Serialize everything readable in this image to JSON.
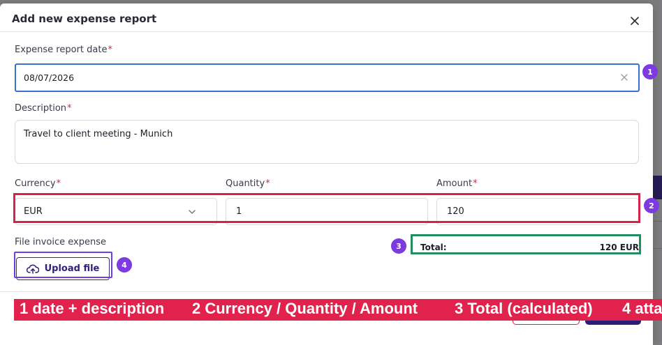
{
  "modal": {
    "title": "Add new expense report"
  },
  "form": {
    "date": {
      "label": "Expense report date",
      "required_mark": "*",
      "value": "08/07/2026"
    },
    "description": {
      "label": "Description",
      "required_mark": "*",
      "value": "Travel to client meeting - Munich"
    },
    "currency": {
      "label": "Currency",
      "required_mark": "*",
      "value": "EUR"
    },
    "quantity": {
      "label": "Quantity",
      "required_mark": "*",
      "value": "1"
    },
    "amount": {
      "label": "Amount",
      "required_mark": "*",
      "value": "120"
    },
    "file": {
      "label": "File invoice expense",
      "upload_label": "Upload file"
    },
    "total": {
      "label": "Total:",
      "value": "120 EUR"
    }
  },
  "badges": [
    "1",
    "2",
    "3",
    "4"
  ],
  "annotation_bar": {
    "items": [
      "1 date + description",
      "2 Currency / Quantity / Amount",
      "3 Total (calculated)",
      "4 atta"
    ]
  },
  "icons": {
    "close": "close-icon",
    "clear": "clear-icon",
    "chevron": "chevron-down-icon",
    "upload": "cloud-upload-icon"
  },
  "colors": {
    "accent": "#2e2178",
    "badge": "#7c3ae0",
    "highlight_red": "#d8214a",
    "highlight_green": "#1f8f5f",
    "focus_blue": "#3a6fd0"
  }
}
